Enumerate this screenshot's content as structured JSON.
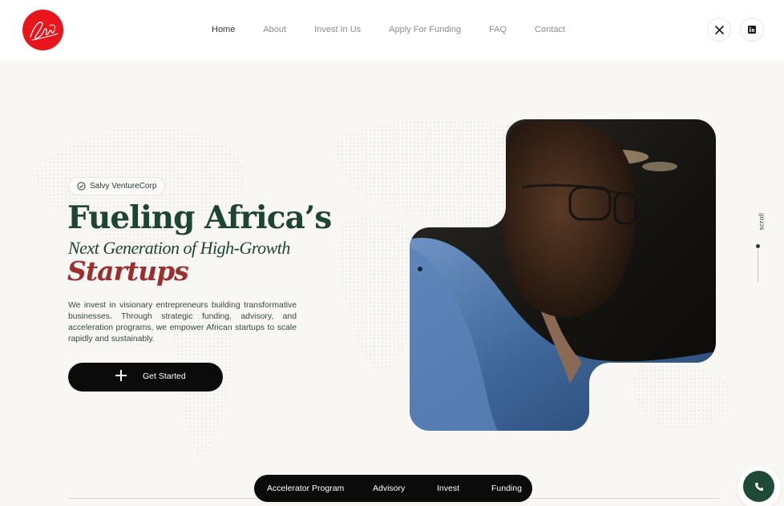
{
  "header": {
    "logo_icon": "salvy-signature-logo",
    "brand_color": "#e8151c",
    "nav": [
      {
        "label": "Home",
        "active": true
      },
      {
        "label": "About",
        "active": false
      },
      {
        "label": "Invest In Us",
        "active": false
      },
      {
        "label": "Apply For Funding",
        "active": false
      },
      {
        "label": "FAQ",
        "active": false
      },
      {
        "label": "Contact",
        "active": false
      }
    ],
    "social": [
      {
        "icon": "x-twitter-icon"
      },
      {
        "icon": "linkedin-icon"
      }
    ]
  },
  "hero": {
    "badge_label": "Salvy VentureCorp",
    "badge_icon": "check-circle-icon",
    "heading_line1": "Fueling Africa’s",
    "heading_line2": "Next Generation of High-Growth",
    "heading_line3": "Startups",
    "description": "We invest in visionary entrepreneurs building transformative businesses. Through strategic funding, advisory, and acceleration programs, we empower African startups to scale rapidly and sustainably.",
    "cta_label": "Get Started",
    "cta_icon": "plus-icon",
    "photo_icon": "entrepreneur-portrait-photo",
    "scroll_label": "scroll",
    "heading_color": "#1e4433",
    "accent_color": "#9b2e2e"
  },
  "bottom_nav": {
    "items": [
      "Accelerator Program",
      "Advisory",
      "Invest",
      "Funding"
    ]
  },
  "floating": {
    "call_icon": "phone-icon",
    "call_color": "#1f4a35"
  }
}
